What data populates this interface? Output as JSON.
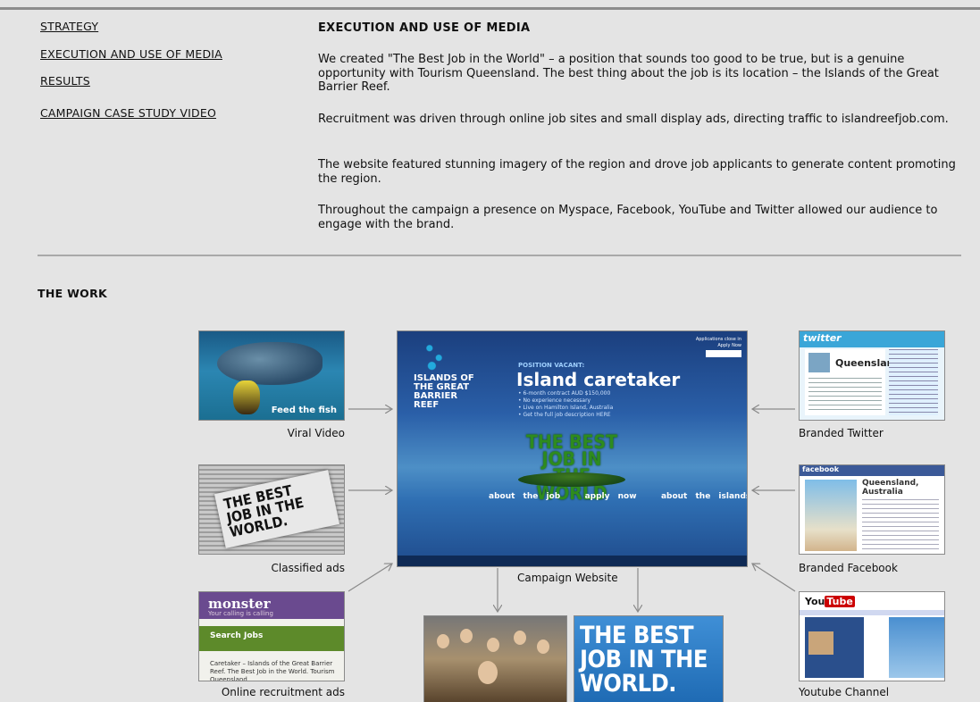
{
  "sidebar": {
    "links": [
      "STRATEGY",
      "EXECUTION AND USE OF MEDIA",
      "RESULTS",
      "CAMPAIGN CASE STUDY VIDEO"
    ]
  },
  "section": {
    "title": "EXECUTION AND USE OF MEDIA",
    "paragraphs": [
      "We created \"The Best Job in the World\" – a position that sounds too good to be true, but is a genuine opportunity with Tourism Queensland. The best thing about the job is its location – the Islands of the Great Barrier Reef.",
      "Recruitment was driven through online job sites and small display ads, directing traffic to islandreefjob.com.",
      "The website featured stunning imagery of the region and drove job applicants to generate content promoting the region.",
      "Throughout the campaign a presence on Myspace, Facebook, YouTube and Twitter allowed our audience to engage with the brand."
    ]
  },
  "work": {
    "title": "THE WORK",
    "captions": {
      "viral_video": "Viral Video",
      "classified_ads": "Classified ads",
      "online_recruitment_ads": "Online recruitment ads",
      "campaign_website": "Campaign Website",
      "branded_twitter": "Branded Twitter",
      "branded_facebook": "Branded Facebook",
      "youtube_channel": "Youtube Channel"
    },
    "thumb_text": {
      "viral": "Feed the fish",
      "classified": "THE BEST JOB IN THE WORLD.",
      "monster_logo": "monster",
      "monster_tag": "Your calling is calling",
      "monster_search": "Search Jobs",
      "monster_listing": "Caretaker – Islands of the Great Barrier Reef. The Best Job in the World. Tourism Queensland",
      "site_logo": "ISLANDS OF THE GREAT BARRIER REEF",
      "site_position": "POSITION VACANT:",
      "site_heading": "Island caretaker",
      "site_bullets": "• 6-month contract AUD $150,000\n• No experience necessary\n• Live on Hamilton Island, Australia\n• Get the full job description HERE",
      "site_best": "THE BEST JOB IN THE WORLD",
      "site_nav": "about the job   apply now   about the islands",
      "site_apps": "Applications close in\nApply Now",
      "twitter_logo": "twitter",
      "twitter_name": "Queensland",
      "facebook_logo": "facebook",
      "facebook_title": "Queensland, Australia",
      "youtube_logo": "You",
      "youtube_tube": "Tube",
      "bestbig": "THE BEST JOB IN THE WORLD."
    }
  },
  "colors": {
    "background": "#e4e4e4",
    "divider": "#a9a9a9",
    "arrow": "#8a8a8a"
  }
}
